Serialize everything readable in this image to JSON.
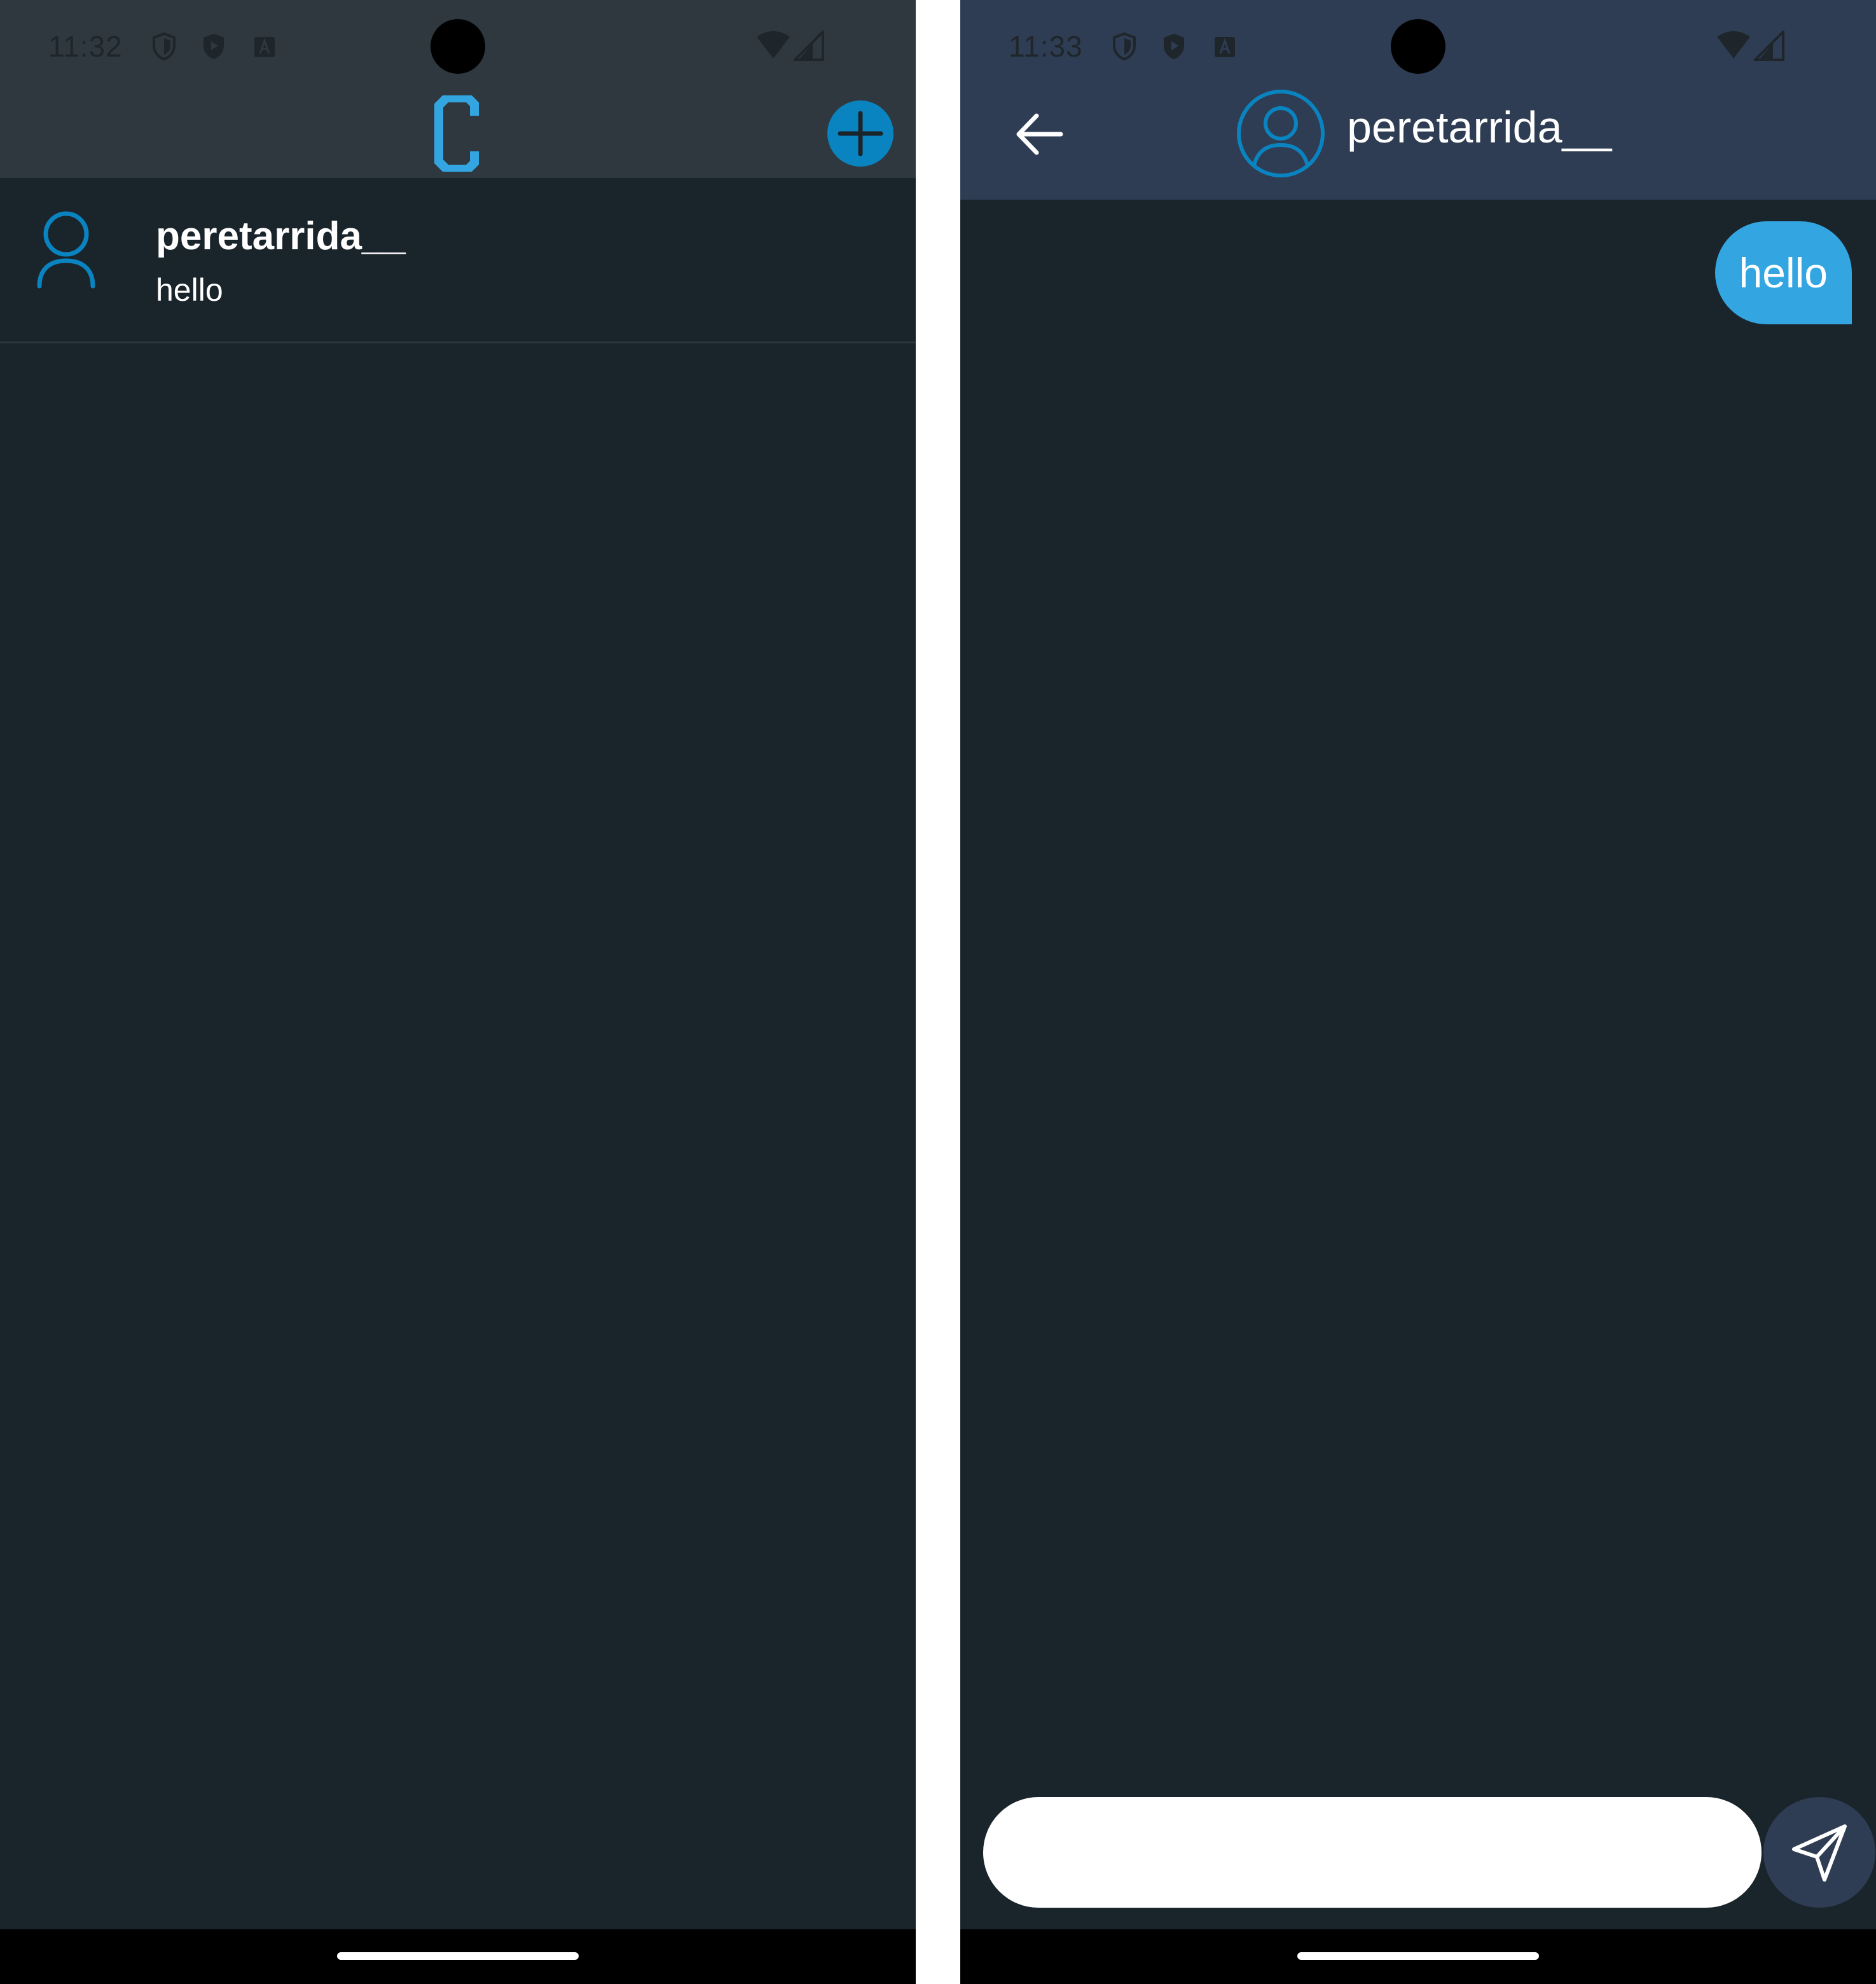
{
  "colors": {
    "background": "#1a242b",
    "list_header": "#2e383e",
    "chat_header": "#2e3d53",
    "accent": "#33a6e2",
    "icon_accent": "#0a84c0"
  },
  "left_screen": {
    "status_time": "11:32",
    "logo_icon": "c-logo-icon",
    "add_icon": "plus-circle-icon",
    "conversations": [
      {
        "name": "peretarrida__",
        "preview": "hello",
        "avatar_icon": "user-icon"
      }
    ]
  },
  "right_screen": {
    "status_time": "11:33",
    "back_icon": "arrow-left-icon",
    "contact_name": "peretarrida__",
    "avatar_icon": "user-circle-icon",
    "messages": [
      {
        "text": "hello",
        "direction": "outgoing"
      }
    ],
    "composer": {
      "value": "",
      "placeholder": ""
    },
    "send_icon": "send-icon"
  }
}
